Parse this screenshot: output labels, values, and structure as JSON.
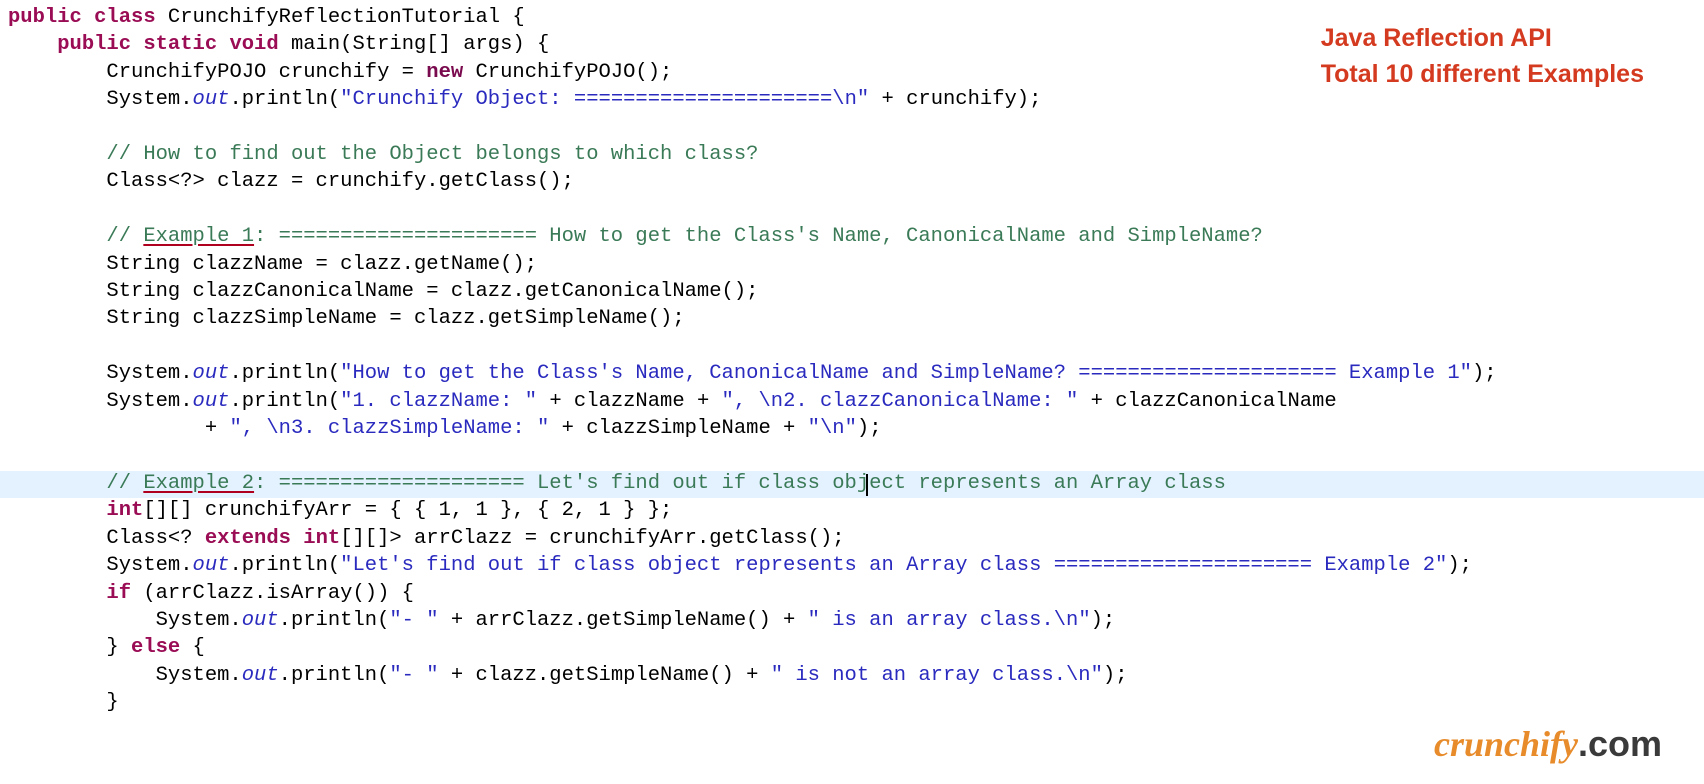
{
  "annot": {
    "line1": "Java Reflection API",
    "line2": "Total 10 different Examples"
  },
  "logo": {
    "brand": "crunchify",
    "tld": ".com"
  },
  "c": {
    "l01_1": "public",
    "l01_2": " class",
    "l01_3": " CrunchifyReflectionTutorial {",
    "l02_1": "public",
    "l02_2": " static",
    "l02_3": " void",
    "l02_4": " main(String[] args) {",
    "l03_1": "CrunchifyPOJO crunchify = ",
    "l03_2": "new",
    "l03_3": " CrunchifyPOJO();",
    "l04_1": "System.",
    "l04_2": "out",
    "l04_3": ".println(",
    "l04_4": "\"Crunchify Object: =====================",
    "l04_5": "\\n",
    "l04_6": "\"",
    "l04_7": " + crunchify);",
    "l06_1": "// How to find out the Object belongs to which class?",
    "l07_1": "Class<?> clazz = crunchify.getClass();",
    "l09_1": "// ",
    "l09_2": "Example 1",
    "l09_3": ": ===================== How to get the Class's Name, CanonicalName and SimpleName?",
    "l10_1": "String clazzName = clazz.getName();",
    "l11_1": "String clazzCanonicalName = clazz.getCanonicalName();",
    "l12_1": "String clazzSimpleName = clazz.getSimpleName();",
    "l14_1": "System.",
    "l14_2": "out",
    "l14_3": ".println(",
    "l14_4": "\"How to get the Class's Name, CanonicalName and SimpleName? ===================== Example 1\"",
    "l14_5": ");",
    "l15_1": "System.",
    "l15_2": "out",
    "l15_3": ".println(",
    "l15_4": "\"1. clazzName: \"",
    "l15_5": " + clazzName + ",
    "l15_6": "\", ",
    "l15_7": "\\n",
    "l15_8": "2. clazzCanonicalName: \"",
    "l15_9": " + clazzCanonicalName",
    "l16_1": "+ ",
    "l16_2": "\", ",
    "l16_3": "\\n",
    "l16_4": "3. clazzSimpleName: \"",
    "l16_5": " + clazzSimpleName + ",
    "l16_6": "\"",
    "l16_7": "\\n",
    "l16_8": "\"",
    "l16_9": ");",
    "l18_1": "// ",
    "l18_2": "Example 2",
    "l18_3": ": ==================== Let's find out if class object represents an Array class",
    "l19_1": "int",
    "l19_2": "[][] crunchifyArr = { { 1, 1 }, { 2, 1 } };",
    "l20_1": "Class<? ",
    "l20_2": "extends",
    "l20_3": " ",
    "l20_4": "int",
    "l20_5": "[][]> arrClazz = crunchifyArr.getClass();",
    "l21_1": "System.",
    "l21_2": "out",
    "l21_3": ".println(",
    "l21_4": "\"Let's find out if class object represents an Array class ===================== Example 2\"",
    "l21_5": ");",
    "l22_1": "if",
    "l22_2": " (arrClazz.isArray()) {",
    "l23_1": "System.",
    "l23_2": "out",
    "l23_3": ".println(",
    "l23_4": "\"- \"",
    "l23_5": " + arrClazz.getSimpleName() + ",
    "l23_6": "\" is an array class.",
    "l23_7": "\\n",
    "l23_8": "\"",
    "l23_9": ");",
    "l24_1": "} ",
    "l24_2": "else",
    "l24_3": " {",
    "l25_1": "System.",
    "l25_2": "out",
    "l25_3": ".println(",
    "l25_4": "\"- \"",
    "l25_5": " + clazz.getSimpleName() + ",
    "l25_6": "\" is not an array class.",
    "l25_7": "\\n",
    "l25_8": "\"",
    "l25_9": ");",
    "l26_1": "}"
  }
}
